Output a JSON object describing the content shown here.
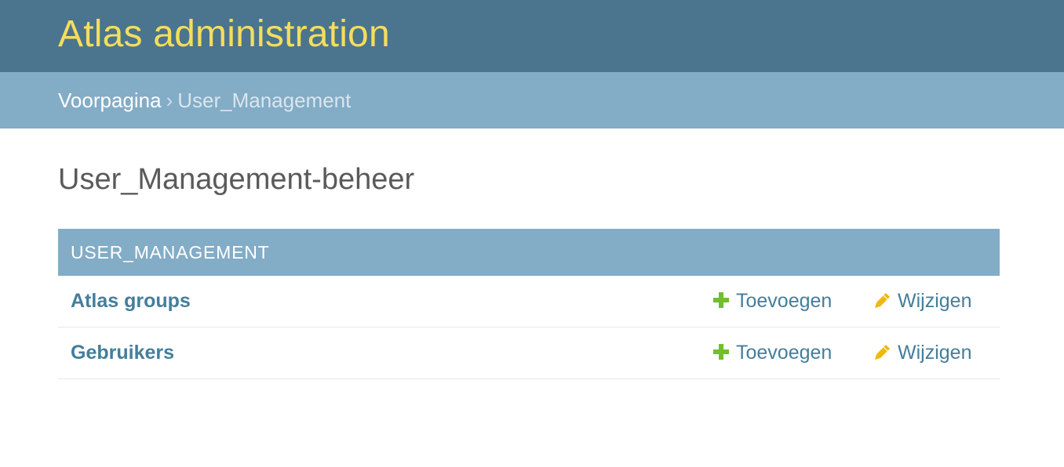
{
  "header": {
    "branding": "Atlas administration"
  },
  "breadcrumbs": {
    "home_label": "Voorpagina",
    "separator": "›",
    "current_label": "User_Management"
  },
  "page": {
    "title": "User_Management-beheer"
  },
  "module": {
    "caption": "USER_MANAGEMENT",
    "rows": [
      {
        "name": "Atlas groups",
        "add_label": "Toevoegen",
        "change_label": "Wijzigen"
      },
      {
        "name": "Gebruikers",
        "add_label": "Toevoegen",
        "change_label": "Wijzigen"
      }
    ]
  },
  "icons": {
    "add": "plus-icon",
    "change": "pencil-icon"
  },
  "colors": {
    "header_bg": "#4b758e",
    "branding_text": "#f5dd5d",
    "breadcrumb_bg": "#83acc6",
    "link": "#447e9b",
    "add_icon": "#70bf2b",
    "change_icon": "#efb80b"
  }
}
